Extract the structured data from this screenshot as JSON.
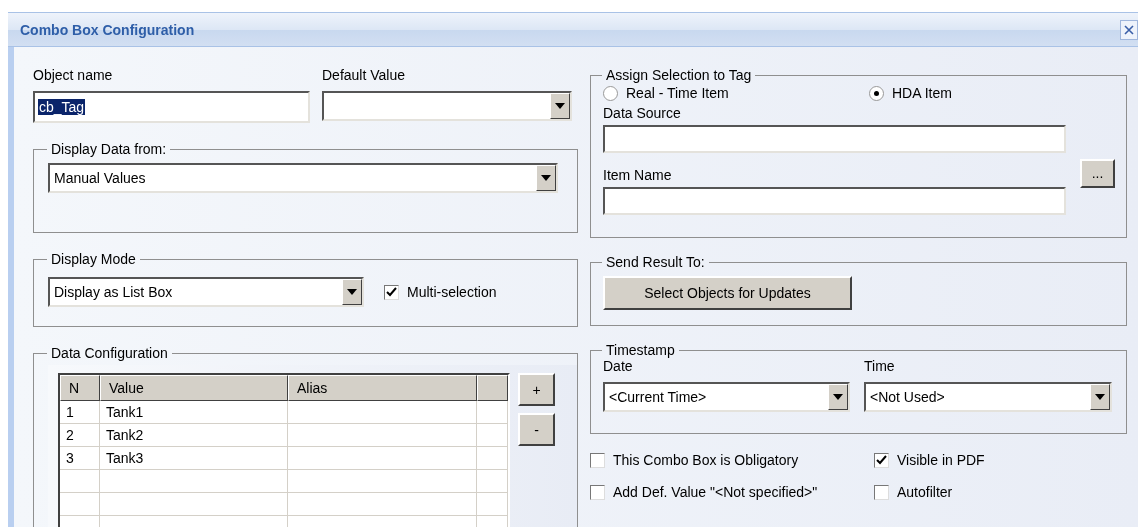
{
  "window": {
    "title": "Combo Box Configuration"
  },
  "object_name": {
    "label": "Object name",
    "value": "cb_Tag",
    "value_selected": true
  },
  "default_value": {
    "label": "Default Value"
  },
  "display_data_from": {
    "title": "Display Data from:",
    "value": "Manual Values"
  },
  "display_mode": {
    "title": "Display Mode",
    "value": "Display as List Box",
    "multi_selection": {
      "label": "Multi-selection",
      "checked": true
    }
  },
  "data_configuration": {
    "title": "Data Configuration",
    "columns": [
      "N",
      "Value",
      "Alias"
    ],
    "rows": [
      {
        "n": "1",
        "value": "Tank1"
      },
      {
        "n": "2",
        "value": "Tank2"
      },
      {
        "n": "3",
        "value": "Tank3"
      }
    ],
    "add_button": "+",
    "remove_button": "-"
  },
  "assign_selection": {
    "title": "Assign Selection to Tag",
    "options": [
      {
        "label": "Real - Time Item",
        "selected": false
      },
      {
        "label": "HDA Item",
        "selected": true
      }
    ],
    "data_source": {
      "label": "Data Source"
    },
    "item_name": {
      "label": "Item Name"
    },
    "browse_button": "..."
  },
  "send_result": {
    "title": "Send Result To:",
    "button": "Select Objects for Updates"
  },
  "timestamp": {
    "title": "Timestamp",
    "date": {
      "label": "Date",
      "value": "<Current Time>"
    },
    "time": {
      "label": "Time",
      "value": "<Not Used>"
    }
  },
  "options": [
    {
      "label": "This Combo Box is Obligatory",
      "checked": false
    },
    {
      "label": "Visible in PDF",
      "checked": true
    },
    {
      "label": "Add Def. Value \"<Not specified>\"",
      "checked": false
    },
    {
      "label": "Autofilter",
      "checked": false
    }
  ]
}
